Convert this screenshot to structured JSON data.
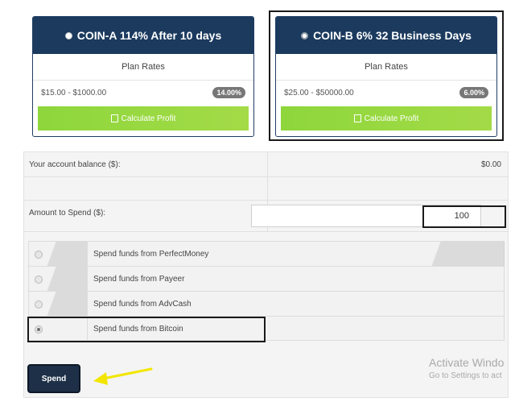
{
  "plans": [
    {
      "title": "COIN-A 114% After 10 days",
      "subtitle": "Plan Rates",
      "range": "$15.00 - $1000.00",
      "rate": "14.00%",
      "button": "Calculate Profit",
      "selected": false
    },
    {
      "title": "COIN-B 6% 32 Business Days",
      "subtitle": "Plan Rates",
      "range": "$25.00 - $50000.00",
      "rate": "6.00%",
      "button": "Calculate Profit",
      "selected": true
    }
  ],
  "form": {
    "balance_label": "Your account balance ($):",
    "balance_value": "$0.00",
    "amount_label": "Amount to Spend ($):",
    "amount_value": "100"
  },
  "payment_options": [
    {
      "label": "Spend funds from PerfectMoney",
      "selected": false
    },
    {
      "label": "Spend funds from Payeer",
      "selected": false
    },
    {
      "label": "Spend funds from AdvCash",
      "selected": false
    },
    {
      "label": "Spend funds from Bitcoin",
      "selected": true
    }
  ],
  "spend_button": "Spend",
  "watermark": {
    "title": "Activate Windo",
    "subtitle": "Go to Settings to act"
  },
  "colors": {
    "plan_header": "#1b3a5e",
    "calc_button": "#9bd940",
    "arrow": "#f2e600",
    "spend_button": "#1e3048"
  }
}
